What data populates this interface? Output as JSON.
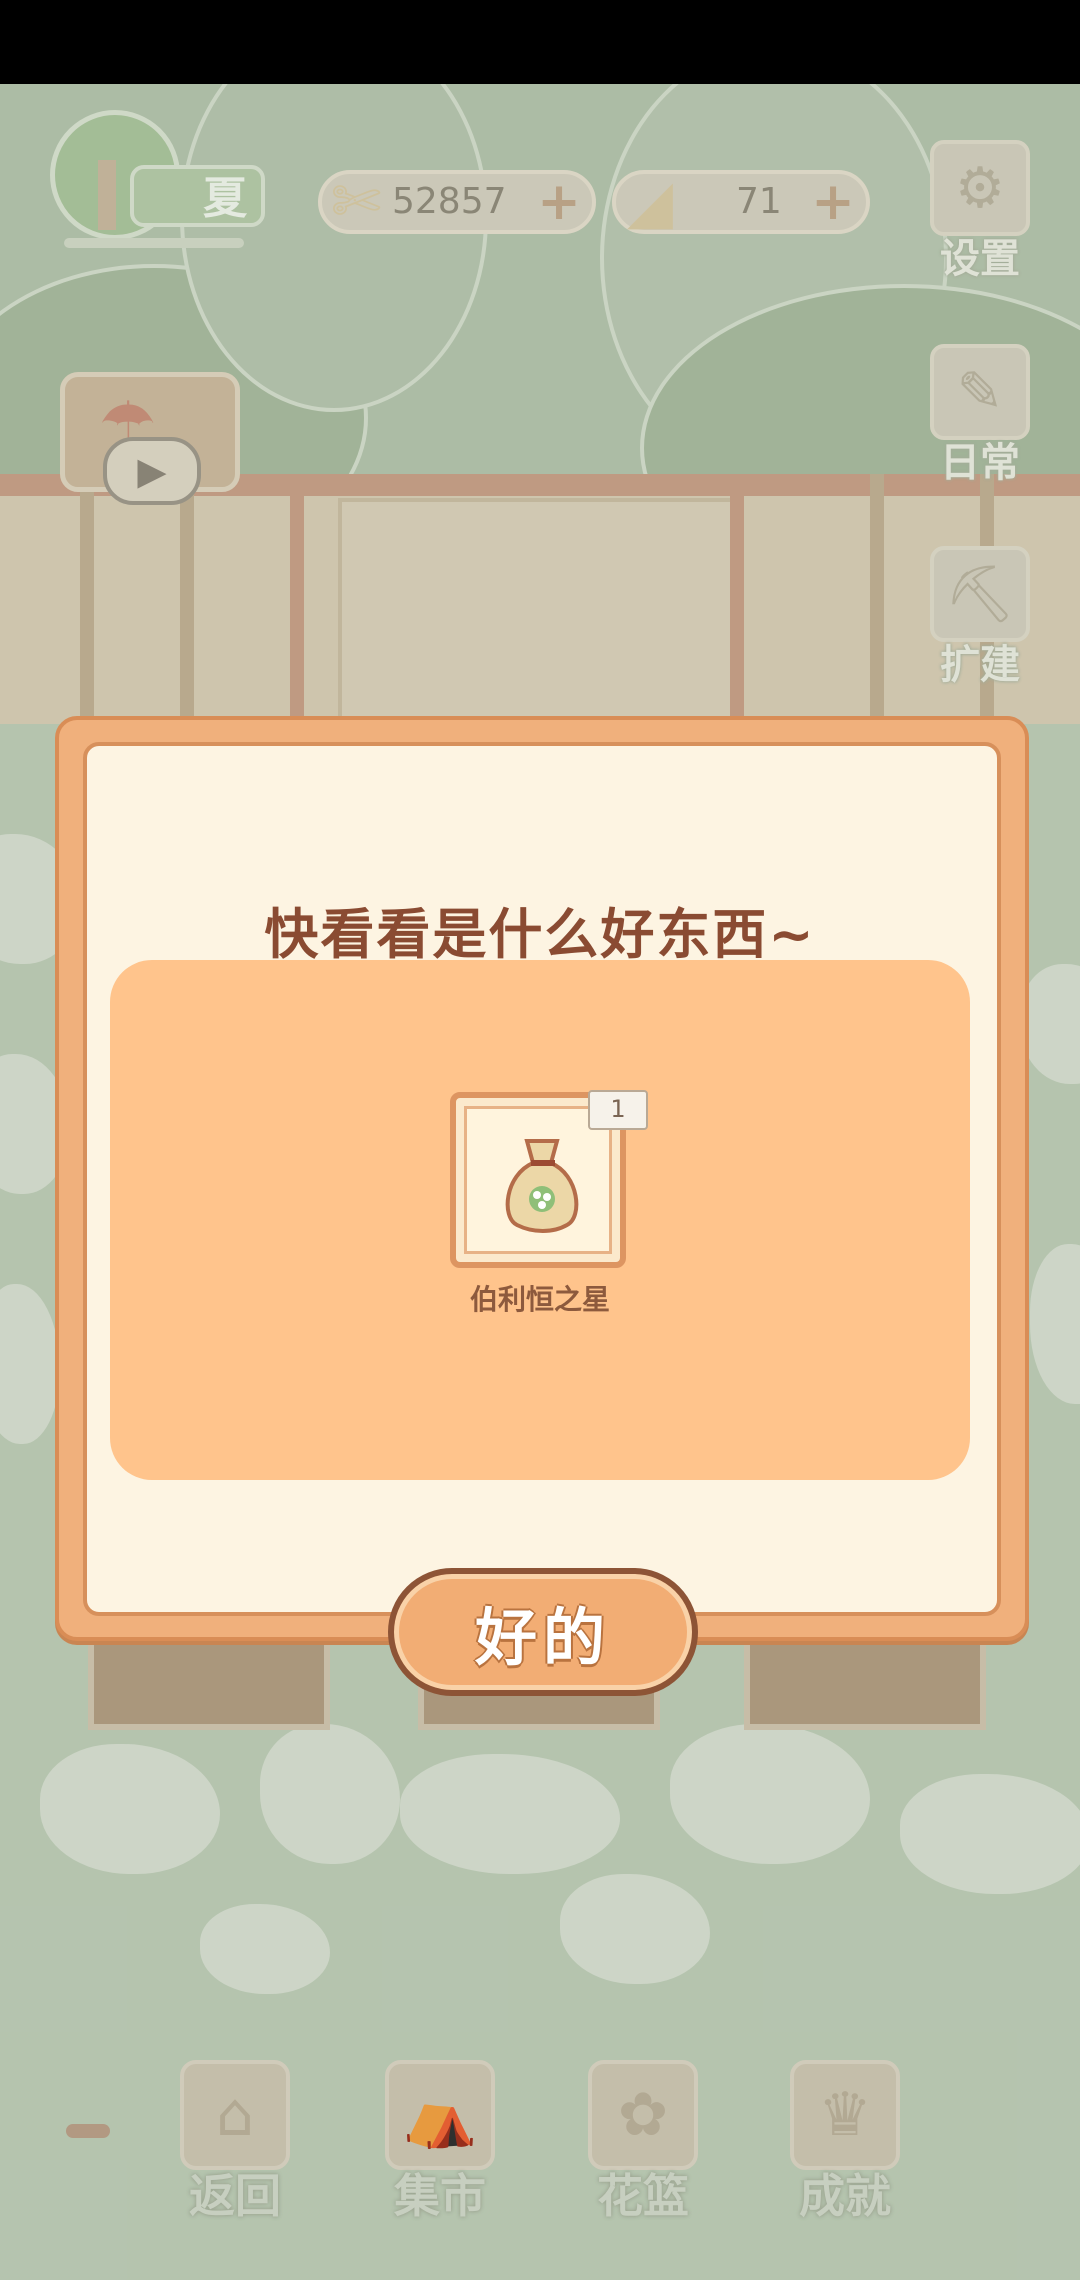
{
  "hud": {
    "season_label": "夏",
    "fish_bones": "52857",
    "cheese": "71",
    "plus_symbol": "+"
  },
  "side_menu": {
    "settings": "设置",
    "daily": "日常",
    "expand": "扩建"
  },
  "bottom_nav": {
    "back": "返回",
    "market": "集市",
    "flower_basket": "花篮",
    "achievements": "成就"
  },
  "dialog": {
    "title": "快看看是什么好东西~",
    "item": {
      "name": "伯利恒之星",
      "count": "1",
      "icon": "seed-bag-icon"
    },
    "ok_button": "好的"
  },
  "colors": {
    "dialog_border": "#f0b07c",
    "panel": "#ffc48c",
    "title_text": "#8a4b32"
  }
}
